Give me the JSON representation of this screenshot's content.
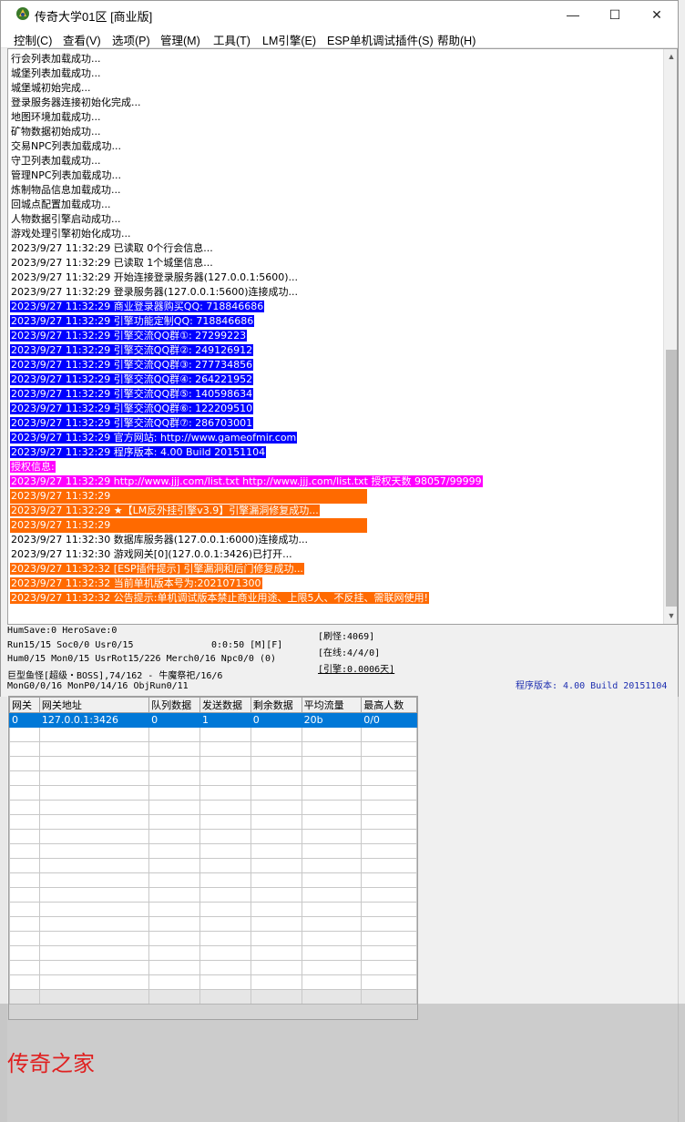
{
  "window": {
    "title": "传奇大学01区 [商业版]",
    "controls": {
      "minimize": "—",
      "maximize": "☐",
      "close": "✕"
    }
  },
  "menu": [
    "控制(C)",
    "查看(V)",
    "选项(P)",
    "管理(M)",
    "工具(T)",
    "LM引擎(E)",
    "ESP单机调试插件(S)",
    "帮助(H)"
  ],
  "log": [
    {
      "text": "行会列表加载成功...",
      "style": "plain"
    },
    {
      "text": "城堡列表加载成功...",
      "style": "plain"
    },
    {
      "text": "城堡城初始完成...",
      "style": "plain"
    },
    {
      "text": "登录服务器连接初始化完成...",
      "style": "plain"
    },
    {
      "text": "地图环境加载成功...",
      "style": "plain"
    },
    {
      "text": "矿物数据初始成功...",
      "style": "plain"
    },
    {
      "text": "交易NPC列表加载成功...",
      "style": "plain"
    },
    {
      "text": "守卫列表加载成功...",
      "style": "plain"
    },
    {
      "text": "管理NPC列表加载成功...",
      "style": "plain"
    },
    {
      "text": "炼制物品信息加载成功...",
      "style": "plain"
    },
    {
      "text": "回城点配置加载成功...",
      "style": "plain"
    },
    {
      "text": "人物数据引擎启动成功...",
      "style": "plain"
    },
    {
      "text": "游戏处理引擎初始化成功...",
      "style": "plain"
    },
    {
      "text": "2023/9/27 11:32:29 已读取 0个行会信息...",
      "style": "plain"
    },
    {
      "text": "2023/9/27 11:32:29 已读取 1个城堡信息...",
      "style": "plain"
    },
    {
      "text": "2023/9/27 11:32:29 开始连接登录服务器(127.0.0.1:5600)...",
      "style": "plain"
    },
    {
      "text": "2023/9/27 11:32:29 登录服务器(127.0.0.1:5600)连接成功...",
      "style": "plain"
    },
    {
      "text": "2023/9/27 11:32:29 商业登录器购买QQ: 718846686",
      "style": "blue"
    },
    {
      "text": "2023/9/27 11:32:29 引擎功能定制QQ: 718846686",
      "style": "blue"
    },
    {
      "text": "2023/9/27 11:32:29 引擎交流QQ群①: 27299223",
      "style": "blue"
    },
    {
      "text": "2023/9/27 11:32:29 引擎交流QQ群②: 249126912",
      "style": "blue"
    },
    {
      "text": "2023/9/27 11:32:29 引擎交流QQ群③: 277734856",
      "style": "blue"
    },
    {
      "text": "2023/9/27 11:32:29 引擎交流QQ群④: 264221952",
      "style": "blue"
    },
    {
      "text": "2023/9/27 11:32:29 引擎交流QQ群⑤: 140598634",
      "style": "blue"
    },
    {
      "text": "2023/9/27 11:32:29 引擎交流QQ群⑥: 122209510",
      "style": "blue"
    },
    {
      "text": "2023/9/27 11:32:29 引擎交流QQ群⑦: 286703001",
      "style": "blue"
    },
    {
      "text": "2023/9/27 11:32:29 官方网站: http://www.gameofmir.com",
      "style": "blue"
    },
    {
      "text": "2023/9/27 11:32:29 程序版本: 4.00 Build 20151104",
      "style": "blue"
    },
    {
      "text": "授权信息:",
      "style": "magenta"
    },
    {
      "text": "2023/9/27 11:32:29 http://www.jjj.com/list.txt http://www.jjj.com/list.txt 授权天数 98057/99999",
      "style": "magenta"
    },
    {
      "text": "2023/9/27 11:32:29",
      "style": "orange-bar"
    },
    {
      "text": "2023/9/27 11:32:29 ★【LM反外挂引擎v3.9】引擎漏洞修复成功...",
      "style": "orange"
    },
    {
      "text": "2023/9/27 11:32:29",
      "style": "orange-bar"
    },
    {
      "text": "2023/9/27 11:32:30 数据库服务器(127.0.0.1:6000)连接成功...",
      "style": "plain"
    },
    {
      "text": "2023/9/27 11:32:30 游戏网关[0](127.0.0.1:3426)已打开...",
      "style": "plain"
    },
    {
      "text": "2023/9/27 11:32:32 [ESP插件提示] 引擎漏洞和后门修复成功...",
      "style": "orange"
    },
    {
      "text": "2023/9/27 11:32:32 当前单机版本号为:2021071300",
      "style": "orange"
    },
    {
      "text": "2023/9/27 11:32:32 公告提示:单机调试版本禁止商业用途、上限5人、不反挂、需联网使用!",
      "style": "orange"
    }
  ],
  "status": {
    "line1": "HumSave:0 HeroSave:0",
    "line2": "Run15/15 Soc0/0 Usr0/15",
    "time": "0:0:50 [M][F]",
    "line3": "Hum0/15 Mon0/15 UsrRot15/226 Merch0/16 Npc0/0 (0)",
    "line4": "巨型鱼怪[超级・BOSS],74/162 - 牛魔祭祀/16/6",
    "line5": "MonG0/0/16 MonP0/14/16 ObjRun0/11",
    "refresh": "[刷怪:4069]",
    "online": "[在线:4/4/0]",
    "engine": "[引擎:0.0006天]",
    "version": "程序版本: 4.00 Build 20151104"
  },
  "gateway_table": {
    "headers": [
      "网关",
      "网关地址",
      "队列数据",
      "发送数据",
      "剩余数据",
      "平均流量",
      "最高人数"
    ],
    "rows": [
      [
        "0",
        "127.0.0.1:3426",
        "0",
        "1",
        "0",
        "20b",
        "0/0"
      ]
    ]
  },
  "watermark": "传奇之家",
  "colors": {
    "log_blue": "#0000ff",
    "log_magenta": "#ff00ff",
    "log_orange": "#ff6a00",
    "selection": "#0078d7",
    "version_text": "#1e2fb0",
    "watermark": "#e02020"
  }
}
